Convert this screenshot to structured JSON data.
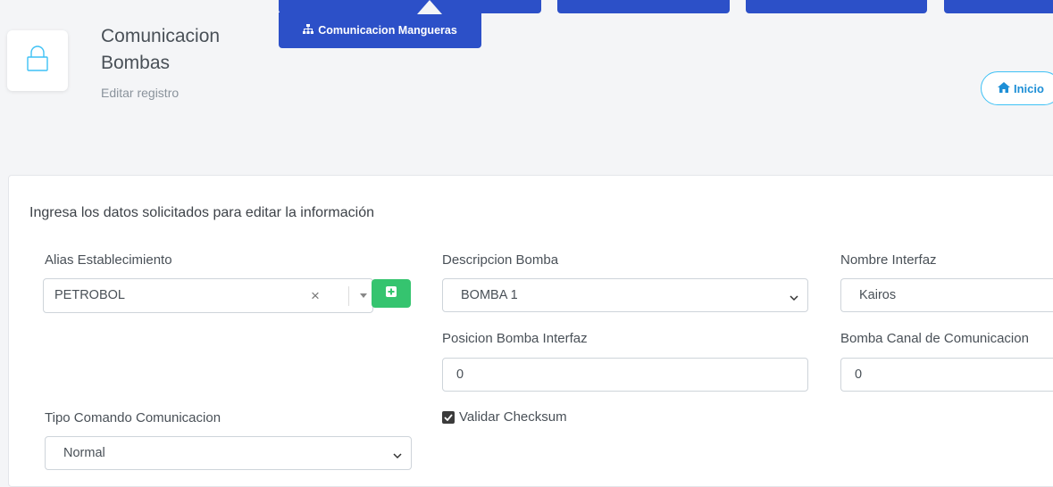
{
  "header": {
    "title": "Comunicacion Bombas",
    "subtitle": "Editar registro",
    "lock_icon": "lock-icon",
    "tab_mangueras_label": "Comunicacion Mangueras",
    "tab_icon": "sitemap-icon",
    "home_button_label": "Inicio",
    "home_icon": "home-icon"
  },
  "form": {
    "intro": "Ingresa los datos solicitados para editar la información",
    "alias": {
      "label": "Alias Establecimiento",
      "value": "PETROBOL",
      "clear_glyph": "×"
    },
    "descripcion": {
      "label": "Descripcion Bomba",
      "value": "BOMBA 1"
    },
    "interfaz": {
      "label": "Nombre Interfaz",
      "value": "Kairos"
    },
    "posicion": {
      "label": "Posicion Bomba Interfaz",
      "value": "0"
    },
    "canal": {
      "label": "Bomba Canal de Comunicacion",
      "value": "0"
    },
    "tipo": {
      "label": "Tipo Comando Comunicacion",
      "value": "Normal"
    },
    "checksum": {
      "label": "Validar Checksum",
      "checked": true
    }
  },
  "colors": {
    "primary_blue": "#2c50c8",
    "success_green": "#35c46f",
    "info_cyan": "#3ec1f5",
    "lock_icon": "#3ec1f5"
  }
}
